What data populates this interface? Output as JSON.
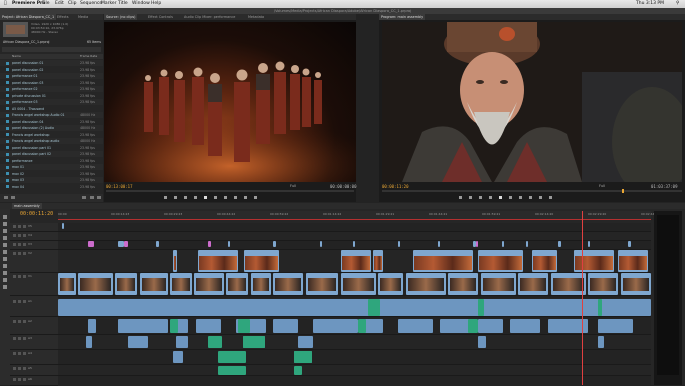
{
  "menu": {
    "apple": "",
    "items": [
      "Premiere Pro",
      "File",
      "Edit",
      "Clip",
      "Sequence",
      "Marker",
      "Title",
      "Window",
      "Help"
    ],
    "clock": "Thu 3:13 PM"
  },
  "window": {
    "title": "/Volumes/Media/Projects/African Diaspora/Adobe/African Diaspora_CC_1.prproj"
  },
  "project_panel": {
    "tabs": [
      "Project: African Diaspora_CC_1",
      "Effects",
      "Media"
    ],
    "sequence_name": "African Diaspora_CC_1.prproj",
    "item_count": "65 Items",
    "preview_info": "Video, 1920 x 1080 (1.0)\n00:03:50:10, 23.976p\n48000 Hz - Stereo",
    "columns": {
      "name": "Name",
      "frame_rate": "Frame Rate"
    },
    "items": [
      {
        "name": "panel discussion 01",
        "fps": "23.98 fps"
      },
      {
        "name": "panel discussion 02",
        "fps": "23.98 fps"
      },
      {
        "name": "performance 01",
        "fps": "23.98 fps"
      },
      {
        "name": "panel discussion 03",
        "fps": "23.98 fps"
      },
      {
        "name": "performance 02",
        "fps": "23.98 fps"
      },
      {
        "name": "private discussion 01",
        "fps": "23.98 fps"
      },
      {
        "name": "performance 03",
        "fps": "23.98 fps"
      },
      {
        "name": "A5 0004 - Thousand",
        "fps": ""
      },
      {
        "name": "Francis angel workshop Audio 01",
        "fps": "48000 Hz"
      },
      {
        "name": "panel discussion 04",
        "fps": "23.98 fps"
      },
      {
        "name": "panel discussion (2) Audio",
        "fps": "48000 Hz"
      },
      {
        "name": "Francis angel workshop",
        "fps": "23.98 fps"
      },
      {
        "name": "Francis angel workshop audio",
        "fps": "48000 Hz"
      },
      {
        "name": "panel discussion part 01",
        "fps": "23.98 fps"
      },
      {
        "name": "panel discussion part 02",
        "fps": "23.98 fps"
      },
      {
        "name": "performance",
        "fps": "23.98 fps"
      },
      {
        "name": "mov 01",
        "fps": "23.98 fps"
      },
      {
        "name": "mov 02",
        "fps": "23.98 fps"
      },
      {
        "name": "mov 03",
        "fps": "23.98 fps"
      },
      {
        "name": "mov 04",
        "fps": "23.98 fps"
      }
    ]
  },
  "source_monitor": {
    "tabs": [
      "Source: (no clips)",
      "Effect Controls",
      "Audio Clip Mixer: performance",
      "Metadata"
    ],
    "timecode_left": "00:13:00:17",
    "fit": "Full",
    "timecode_right": "00:00:00:00"
  },
  "program_monitor": {
    "tab": "Program: main assembly",
    "timecode_left": "00:00:11:20",
    "fit": "Full",
    "timecode_right": "01:03:37:09"
  },
  "timeline": {
    "tab": "main assembly",
    "timecode": "00:00:11:20",
    "ruler_labels": [
      "00:00",
      "00:00:14:23",
      "00:00:29:23",
      "00:00:44:22",
      "00:00:59:22",
      "00:01:14:22",
      "00:01:29:21",
      "00:01:44:21",
      "00:01:59:21",
      "00:02:14:20",
      "00:02:29:20",
      "00:02:44:19"
    ],
    "track_labels": [
      "V5",
      "V4",
      "V3",
      "V2",
      "V1",
      "A1",
      "A2",
      "A3",
      "A4",
      "A5",
      "A6"
    ],
    "clip_labels": [
      "performance",
      "audience",
      "dancing",
      "Francis",
      "performance 02",
      "panel"
    ]
  },
  "colors": {
    "accent_timecode": "#e9a634",
    "video_clip": "#7fa7cf",
    "audio_clip": "#6d96c0",
    "audio_clip_alt": "#2fa67d",
    "adjustment_clip": "#cc6ccc",
    "playhead": "#e04040"
  }
}
